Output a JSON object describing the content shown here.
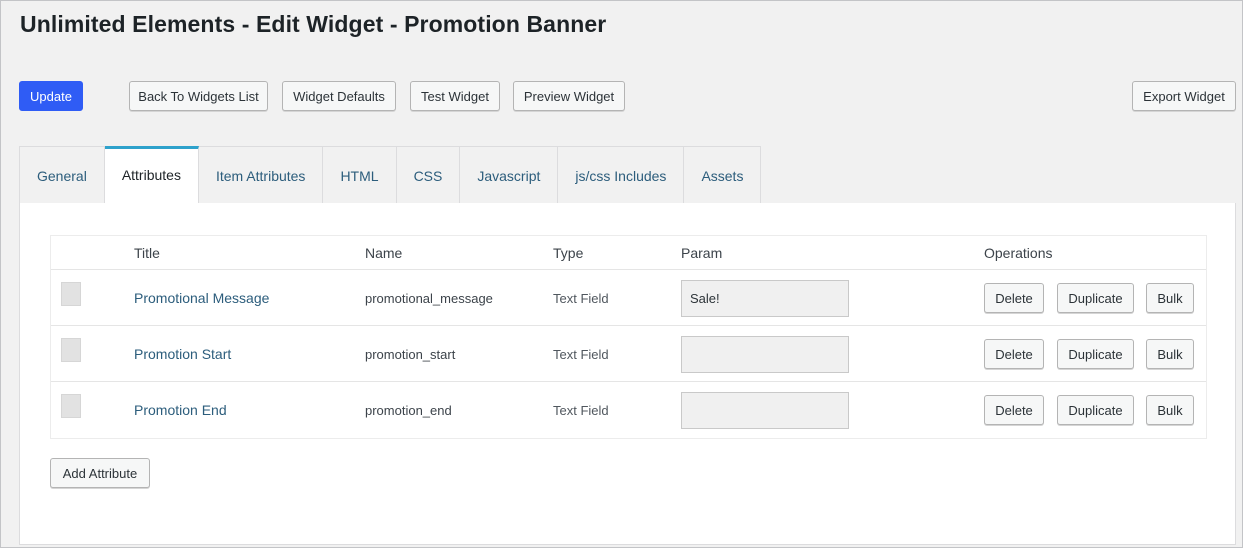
{
  "header": {
    "title": "Unlimited Elements - Edit Widget - Promotion Banner"
  },
  "toolbar": {
    "update_label": "Update",
    "back_label": "Back To Widgets List",
    "defaults_label": "Widget Defaults",
    "test_label": "Test Widget",
    "preview_label": "Preview Widget",
    "export_label": "Export Widget"
  },
  "tabs": [
    {
      "label": "General"
    },
    {
      "label": "Attributes",
      "active": true
    },
    {
      "label": "Item Attributes"
    },
    {
      "label": "HTML"
    },
    {
      "label": "CSS"
    },
    {
      "label": "Javascript"
    },
    {
      "label": "js/css Includes"
    },
    {
      "label": "Assets"
    }
  ],
  "table": {
    "columns": {
      "title": "Title",
      "name": "Name",
      "type": "Type",
      "param": "Param",
      "operations": "Operations"
    },
    "rows": [
      {
        "title": "Promotional Message",
        "name": "promotional_message",
        "type": "Text Field",
        "param": "Sale!"
      },
      {
        "title": "Promotion Start",
        "name": "promotion_start",
        "type": "Text Field",
        "param": ""
      },
      {
        "title": "Promotion End",
        "name": "promotion_end",
        "type": "Text Field",
        "param": ""
      }
    ],
    "ops": {
      "delete_label": "Delete",
      "duplicate_label": "Duplicate",
      "bulk_label": "Bulk"
    }
  },
  "add_attribute_label": "Add Attribute",
  "colors": {
    "primary": "#2f5cf5",
    "link": "#2c5d7c",
    "active_tab_accent": "#2ea2cc"
  }
}
